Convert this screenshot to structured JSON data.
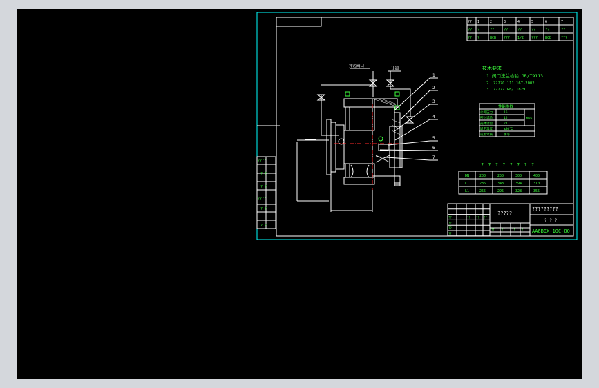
{
  "colors": {
    "background": "#000000",
    "frame": "#00ffff",
    "text_primary": "#ffffff",
    "text_secondary": "#3cff3c",
    "centerline": "#ff2a2a",
    "window_border": "#d4d7dc"
  },
  "revision_table": {
    "row1": [
      "??",
      "1",
      "2",
      "3",
      "4",
      "5",
      "6",
      "7"
    ],
    "row2": [
      "??",
      "?",
      "??",
      "??",
      "??",
      "??",
      "??",
      "??"
    ],
    "row3": [
      "??",
      "?",
      "WCB",
      "???",
      "1/2",
      "???",
      "WCB",
      "???"
    ]
  },
  "valve_labels": {
    "left_valve": "排污阀口",
    "right_valve": "计阀"
  },
  "tech_notes": {
    "title": "技术要求",
    "line1": "1.阀门法兰检验 GB/T9113",
    "line2": "2. ????C.111 167-2002",
    "line3": "3. ?????    GB/T1829"
  },
  "perf_table": {
    "title": "性能参数",
    "rows": [
      [
        "公称压力",
        "16",
        ""
      ],
      [
        "密封试验",
        "15",
        "MPa"
      ],
      [
        "壳体试验",
        "24",
        ""
      ],
      [
        "适用温度",
        "≤80℃",
        ""
      ],
      [
        "适用介质",
        "水等",
        ""
      ]
    ]
  },
  "dim_table": {
    "title": "? ? ? ? ? ? ? ?",
    "rows": [
      [
        "DN",
        "200",
        "250",
        "300",
        "400"
      ],
      [
        "L",
        "286",
        "348",
        "394",
        "310"
      ],
      [
        "L1",
        "255",
        "295",
        "328",
        "355"
      ]
    ]
  },
  "part_numbers": [
    "1",
    "2",
    "3",
    "4",
    "5",
    "6",
    "7"
  ],
  "title_block": {
    "company": "?????????",
    "drawing_title": "?????",
    "subtitle": "? ? ?",
    "drawing_no": "AA6B0X-10C-00",
    "rows": [
      [
        "",
        "",
        "",
        "",
        ""
      ],
      [
        "",
        "",
        "",
        "",
        ""
      ],
      [
        "??",
        "",
        "??",
        "??",
        "??"
      ],
      [
        "??",
        "",
        "",
        "",
        ""
      ],
      [
        "??",
        "",
        "",
        "",
        ""
      ],
      [
        "??",
        "",
        "",
        "",
        ""
      ]
    ],
    "scale_row": [
      "??",
      "??",
      "??",
      "?"
    ]
  },
  "left_strip": {
    "labels": [
      "????",
      "? ?",
      "? ?",
      "????",
      "? ?",
      "? ?"
    ]
  }
}
